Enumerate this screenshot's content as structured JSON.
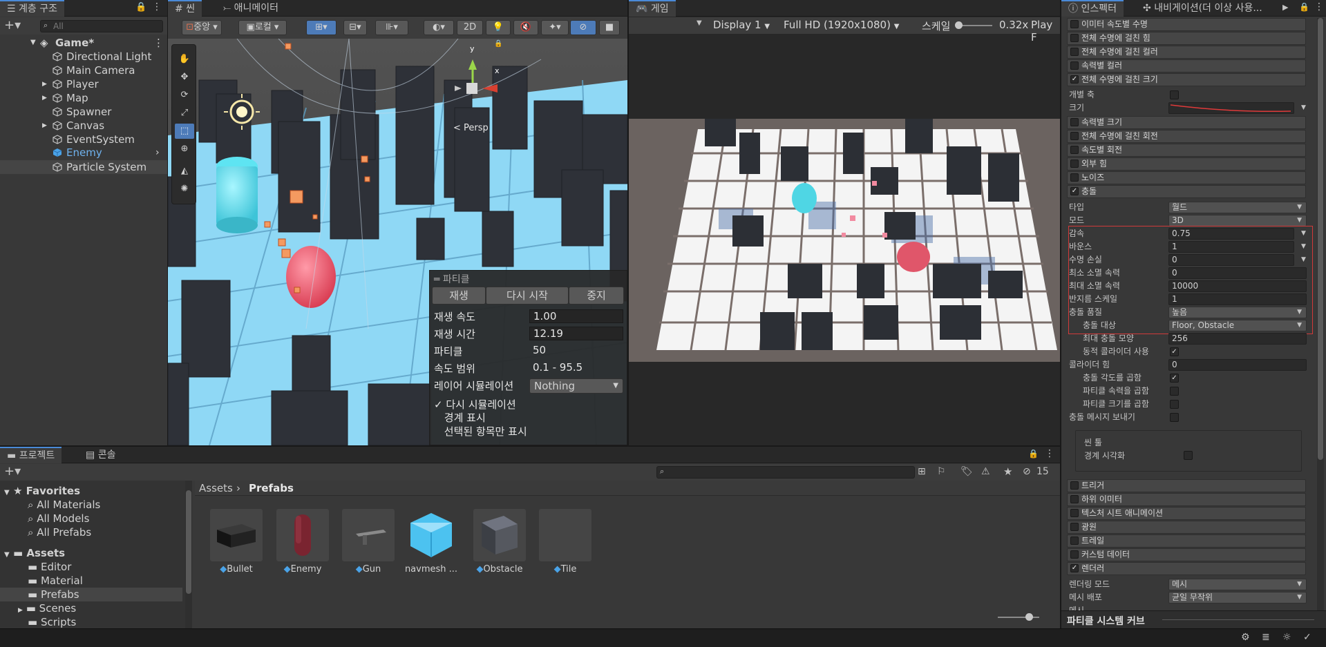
{
  "hierarchy": {
    "tab_label": "계층 구조",
    "search_placeholder": "All",
    "scene_name": "Game*",
    "items": [
      {
        "label": "Directional Light"
      },
      {
        "label": "Main Camera"
      },
      {
        "label": "Player"
      },
      {
        "label": "Map"
      },
      {
        "label": "Spawner"
      },
      {
        "label": "Canvas"
      },
      {
        "label": "EventSystem"
      },
      {
        "label": "Enemy"
      },
      {
        "label": "Particle System"
      }
    ]
  },
  "scene": {
    "tab_label": "씬",
    "animator_tab": "애니메이터",
    "pivot_label": "중앙",
    "space_label": "로컬",
    "mode_2d": "2D",
    "persp_label": "Persp",
    "gizmo_y": "y",
    "gizmo_x": "x",
    "particle_panel": {
      "title": "파티클",
      "play": "재생",
      "restart": "다시 시작",
      "stop": "중지",
      "rows": [
        {
          "label": "재생 속도",
          "value": "1.00"
        },
        {
          "label": "재생 시간",
          "value": "12.19"
        },
        {
          "label": "파티클",
          "value": "50"
        },
        {
          "label": "속도 범위",
          "value": "0.1 - 95.5"
        }
      ],
      "layer_label": "레이어 시뮬레이션",
      "layer_value": "Nothing",
      "resimulate": "다시 시뮬레이션",
      "show_bounds": "경계 표시",
      "show_selected": "선택된 항목만 표시"
    }
  },
  "game": {
    "tab_label": "게임",
    "display": "Display 1",
    "resolution": "Full HD (1920x1080)",
    "scale_label": "스케일",
    "scale_value": "0.32x",
    "play_label": "Play F"
  },
  "inspector": {
    "tab_label": "인스펙터",
    "nav_tab": "내비게이션(더 이상 사용...",
    "modules_top": [
      {
        "label": "이미터 속도별 수명",
        "checked": false
      },
      {
        "label": "전체 수명에 걸친 힘",
        "checked": false
      },
      {
        "label": "전체 수명에 걸친 컬러",
        "checked": false
      },
      {
        "label": "속력별 컬러",
        "checked": false
      },
      {
        "label": "전체 수명에 걸친 크기",
        "checked": true
      }
    ],
    "separate_axes": "개별 축",
    "size": "크기",
    "modules_mid": [
      {
        "label": "속력별 크기",
        "checked": false
      },
      {
        "label": "전체 수명에 걸친 회전",
        "checked": false
      },
      {
        "label": "속도별 회전",
        "checked": false
      },
      {
        "label": "외부 힘",
        "checked": false
      },
      {
        "label": "노이즈",
        "checked": false
      },
      {
        "label": "충돌",
        "checked": true
      }
    ],
    "collision": {
      "type_label": "타입",
      "type_value": "월드",
      "mode_label": "모드",
      "mode_value": "3D",
      "dampen_label": "감속",
      "dampen_value": "0.75",
      "bounce_label": "바운스",
      "bounce_value": "1",
      "lifetime_loss_label": "수명 손실",
      "lifetime_loss_value": "0",
      "min_kill_label": "최소 소멸 속력",
      "min_kill_value": "0",
      "max_kill_label": "최대 소멸 속력",
      "max_kill_value": "10000",
      "radius_label": "반지름 스케일",
      "radius_value": "1",
      "quality_label": "충돌 품질",
      "quality_value": "높음",
      "collides_label": "충돌 대상",
      "collides_value": "Floor, Obstacle",
      "max_shapes_label": "최대 충돌 모양",
      "max_shapes_value": "256",
      "dynamic_label": "동적 콜라이더 사용",
      "collider_force_label": "콜라이더 힘",
      "collider_force_value": "0",
      "angle_label": "충돌 각도를 곱함",
      "speed_label": "파티클 속력을 곱함",
      "size_label": "파티클 크기를 곱함",
      "send_label": "충돌 메시지 보내기",
      "scene_tools": "씬 툴",
      "visualize": "경계 시각화"
    },
    "modules_bottom": [
      {
        "label": "트리거",
        "checked": false
      },
      {
        "label": "하위 이미터",
        "checked": false
      },
      {
        "label": "텍스처 시트 애니메이션",
        "checked": false
      },
      {
        "label": "광원",
        "checked": false
      },
      {
        "label": "트레일",
        "checked": false
      },
      {
        "label": "커스텀 데이터",
        "checked": false
      },
      {
        "label": "렌더러",
        "checked": true
      }
    ],
    "render_mode_label": "렌더링 모드",
    "render_mode_value": "메시",
    "mesh_dist_label": "메시 배포",
    "mesh_dist_value": "균일 무작위",
    "mesh_label": "메시",
    "curves_title": "파티클 시스템 커브"
  },
  "project": {
    "tab_label": "프로젝트",
    "console_tab": "콘솔",
    "hidden_count": "15",
    "favorites_label": "Favorites",
    "favorites": [
      "All Materials",
      "All Models",
      "All Prefabs"
    ],
    "assets_label": "Assets",
    "folders": [
      "Editor",
      "Material",
      "Prefabs",
      "Scenes",
      "Scripts"
    ],
    "breadcrumb_root": "Assets",
    "breadcrumb_current": "Prefabs",
    "assets": [
      {
        "label": "Bullet"
      },
      {
        "label": "Enemy"
      },
      {
        "label": "Gun"
      },
      {
        "label": "navmesh ..."
      },
      {
        "label": "Obstacle"
      },
      {
        "label": "Tile"
      }
    ]
  },
  "colors": {
    "accent": "#4a8ad8",
    "highlight": "#d23a3a",
    "enemy": "#e0566a",
    "player": "#4fd6e4"
  }
}
